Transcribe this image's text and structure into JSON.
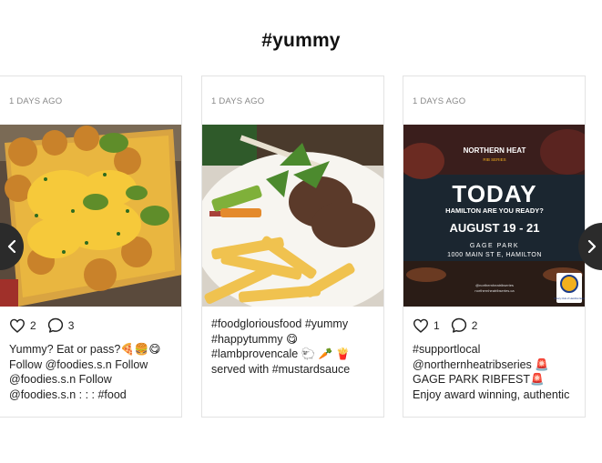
{
  "feed": {
    "hashtag": "#yummy"
  },
  "posts": [
    {
      "time": "1 DAYS AGO",
      "image": "loaded-tater-tots-photo",
      "likes": "2",
      "comments": "3",
      "caption": [
        "Yummy? Eat or pass?🍕🍔😋",
        "Follow @foodies.s.n Follow",
        "@foodies.s.n Follow",
        "@foodies.s.n : : : #food"
      ]
    },
    {
      "time": "1 DAYS AGO",
      "image": "lamb-chops-fries-photo",
      "likes": "",
      "comments": "",
      "caption": [
        "#foodgloriousfood #yummy",
        "#happytummy 😋",
        "#lambprovencale 🐑 🥕 🍟",
        "served with #mustardsauce"
      ]
    },
    {
      "time": "1 DAYS AGO",
      "image": "ribfest-event-poster",
      "likes": "1",
      "comments": "2",
      "caption": [
        "#supportlocal",
        "@northernheatribseries 🚨",
        "GAGE PARK RIBFEST🚨",
        "Enjoy award winning, authentic"
      ],
      "poster": {
        "brand": "NORTHERN HEAT",
        "brand_sub": "RIB SERIES",
        "headline": "TODAY",
        "tagline": "HAMILTON ARE YOU READY?",
        "dates": "AUGUST 19 - 21",
        "venue": "GAGE PARK",
        "address": "1000 MAIN ST E, HAMILTON",
        "handle1": "@northernheatribseries",
        "handle2": "northernheatribseries.ca",
        "sponsor": "Rotary Club of Hamilton East"
      }
    }
  ],
  "nav": {
    "prev_icon": "chevron-left-icon",
    "next_icon": "chevron-right-icon"
  },
  "colors": {
    "nav_bg": "#2b2b2b",
    "card_border": "#e3e3e3",
    "poster_bg": "#1b2630",
    "poster_accent": "#f2b01e"
  }
}
